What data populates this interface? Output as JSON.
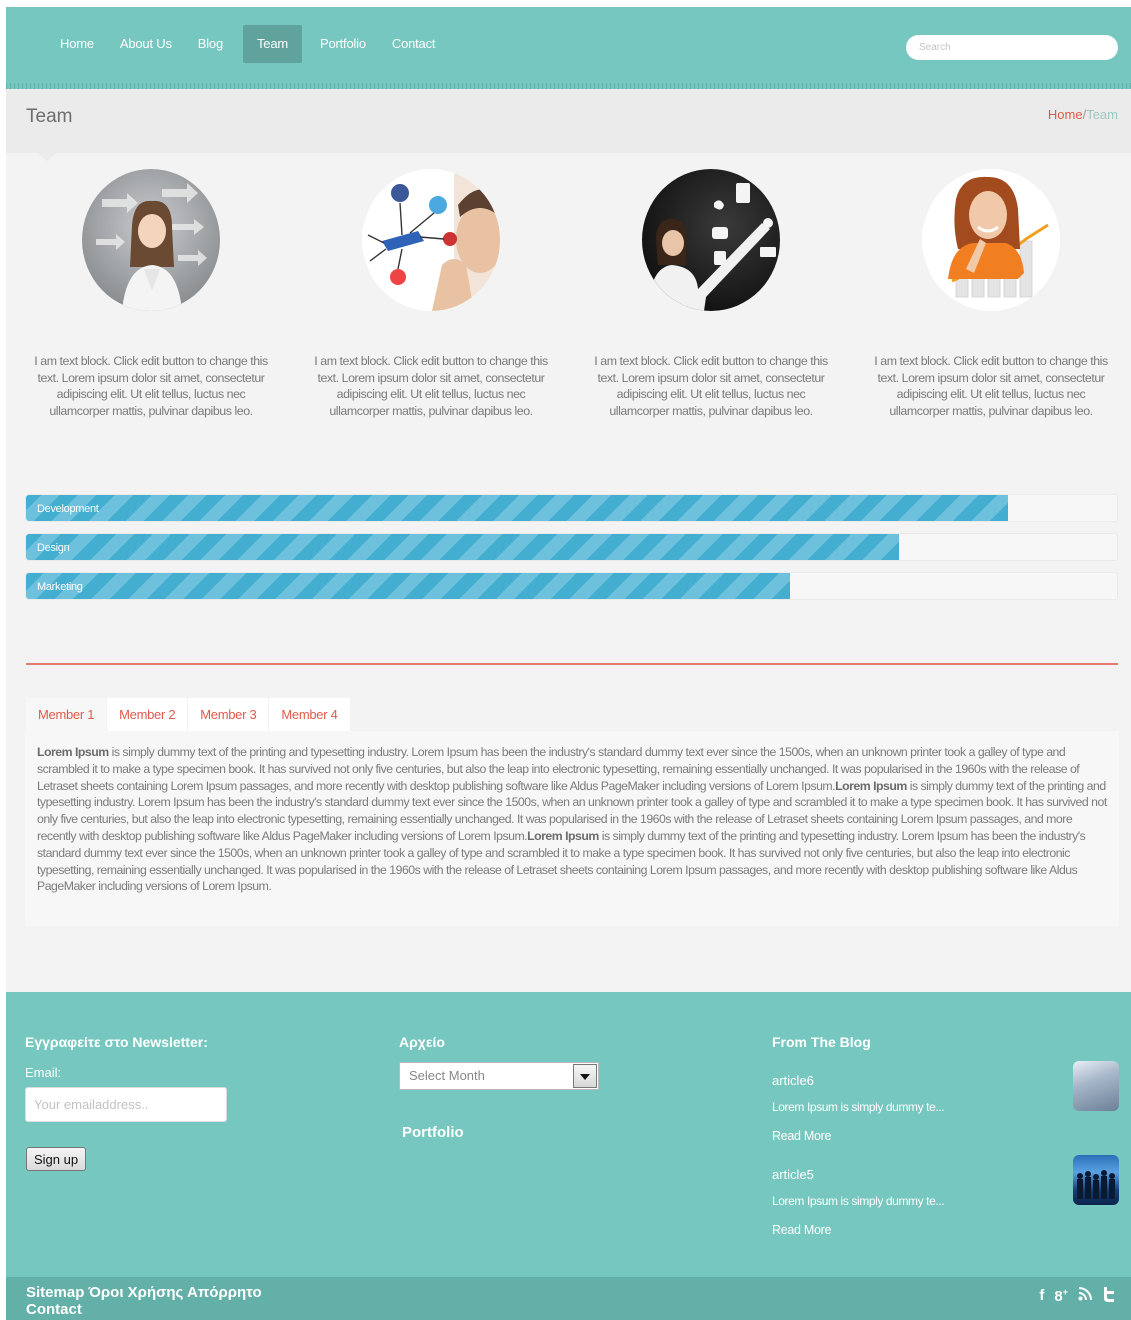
{
  "nav": {
    "items": [
      {
        "label": "Home"
      },
      {
        "label": "About Us"
      },
      {
        "label": "Blog"
      },
      {
        "label": "Team",
        "active": true
      },
      {
        "label": "Portfolio"
      },
      {
        "label": "Contact"
      }
    ],
    "search_placeholder": "Search"
  },
  "page": {
    "title": "Team",
    "breadcrumb": {
      "home": "Home",
      "separator": "/",
      "current": "Team"
    }
  },
  "team": [
    {
      "text": "I am text block. Click edit button to change this text. Lorem ipsum dolor sit amet, consectetur adipiscing elit. Ut elit tellus, luctus nec ullamcorper mattis, pulvinar dapibus leo."
    },
    {
      "text": "I am text block. Click edit button to change this text. Lorem ipsum dolor sit amet, consectetur adipiscing elit. Ut elit tellus, luctus nec ullamcorper mattis, pulvinar dapibus leo."
    },
    {
      "text": "I am text block. Click edit button to change this text. Lorem ipsum dolor sit amet, consectetur adipiscing elit. Ut elit tellus, luctus nec ullamcorper mattis, pulvinar dapibus leo."
    },
    {
      "text": "I am text block. Click edit button to change this text. Lorem ipsum dolor sit amet, consectetur adipiscing elit. Ut elit tellus, luctus nec ullamcorper mattis, pulvinar dapibus leo."
    }
  ],
  "skills": [
    {
      "label": "Development",
      "percent": 90
    },
    {
      "label": "Design",
      "percent": 80
    },
    {
      "label": "Marketing",
      "percent": 70
    }
  ],
  "tabs": {
    "items": [
      "Member 1",
      "Member 2",
      "Member 3",
      "Member 4"
    ],
    "active": 0,
    "panel": {
      "bold": "Lorem Ipsum",
      "body": " is simply dummy text of the printing and typesetting industry. Lorem Ipsum has been the industry's standard dummy text ever since the 1500s, when an unknown printer took a galley of type and scrambled it to make a type specimen book. It has survived not only five centuries, but also the leap into electronic typesetting, remaining essentially unchanged. It was popularised in the 1960s with the release of Letraset sheets containing Lorem Ipsum passages, and more recently with desktop publishing software like Aldus PageMaker including versions of Lorem Ipsum.",
      "body_2": " is simply dummy text of the printing and typesetting industry. Lorem Ipsum has been the industry's standard dummy text ever since the 1500s, when an unknown printer took a galley of type and scrambled it to make a type specimen book. It has survived not only five centuries, but also the leap into electronic typesetting, remaining essentially unchanged. It was popularised in the 1960s with the release of Letraset sheets containing Lorem Ipsum passages, and more recently with desktop publishing software like Aldus PageMaker including versions of Lorem Ipsum.",
      "body_3": " is simply dummy text of the printing and typesetting industry. Lorem Ipsum has been the industry's standard dummy text ever since the 1500s, when an unknown printer took a galley of type and scrambled it to make a type specimen book. It has survived not only five centuries, but also the leap into electronic typesetting, remaining essentially unchanged. It was popularised in the 1960s with the release of Letraset sheets containing Lorem Ipsum passages, and more recently with desktop publishing software like Aldus PageMaker including versions of Lorem Ipsum."
    }
  },
  "footer": {
    "newsletter": {
      "title": "Εγγραφείτε στο Newsletter:",
      "email_label": "Email:",
      "email_placeholder": "Your emailaddress..",
      "button": "Sign up"
    },
    "archive": {
      "title": "Αρχείο",
      "select_value": "Select Month",
      "portfolio_link": "Portfolio"
    },
    "blog": {
      "title": "From The Blog",
      "posts": [
        {
          "title": "article6",
          "excerpt": "Lorem Ipsum is simply dummy te...",
          "more": "Read More"
        },
        {
          "title": "article5",
          "excerpt": "Lorem Ipsum is simply dummy te...",
          "more": "Read More"
        }
      ]
    }
  },
  "bottom": {
    "links": [
      "Sitemap",
      "Όροι Χρήσης",
      "Απόρρητο",
      "Contact"
    ],
    "social": [
      "f",
      "8+",
      "rss",
      "t"
    ]
  },
  "colors": {
    "primary": "#76c7bf",
    "accent": "#e05a4c",
    "progress": "#44aed0"
  }
}
